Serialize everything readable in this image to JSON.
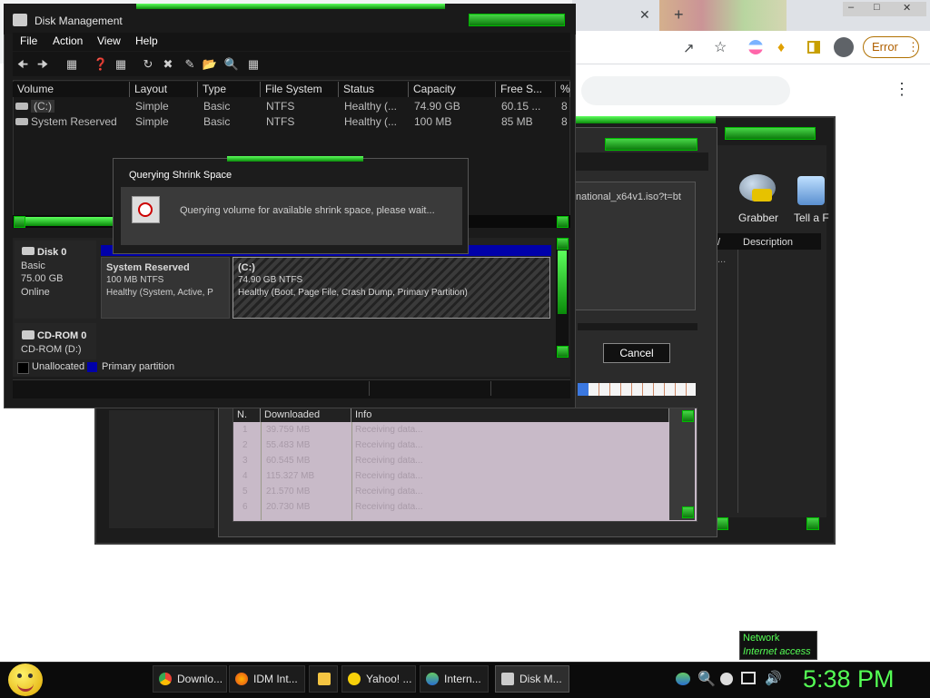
{
  "chrome": {
    "close_tab": "✕",
    "new_tab": "+",
    "error_label": "Error",
    "more": "⋮"
  },
  "idm": {
    "tools": [
      {
        "label": "Grabber"
      },
      {
        "label": "Tell a F"
      }
    ],
    "desc_header": "Description",
    "dl_partial": "national_x64v1.iso?t=bt",
    "cancel_label": "Cancel",
    "table_headers": [
      "N.",
      "Downloaded",
      "Info"
    ],
    "rows": [
      {
        "n": "1",
        "dl": "39.759 MB",
        "info": "Receiving data..."
      },
      {
        "n": "2",
        "dl": "55.483 MB",
        "info": "Receiving data..."
      },
      {
        "n": "3",
        "dl": "60.545 MB",
        "info": "Receiving data..."
      },
      {
        "n": "4",
        "dl": "115.327 MB",
        "info": "Receiving data..."
      },
      {
        "n": "5",
        "dl": "21.570 MB",
        "info": "Receiving data..."
      },
      {
        "n": "6",
        "dl": "20.730 MB",
        "info": "Receiving data..."
      }
    ]
  },
  "disk_mgmt": {
    "title": "Disk Management",
    "menu": [
      "File",
      "Action",
      "View",
      "Help"
    ],
    "columns": [
      "Volume",
      "Layout",
      "Type",
      "File System",
      "Status",
      "Capacity",
      "Free S...",
      "%"
    ],
    "volumes": [
      {
        "volume": "(C:)",
        "layout": "Simple",
        "type": "Basic",
        "fs": "NTFS",
        "status": "Healthy (...",
        "capacity": "74.90 GB",
        "free": "60.15 ...",
        "pct": "8"
      },
      {
        "volume": "System Reserved",
        "layout": "Simple",
        "type": "Basic",
        "fs": "NTFS",
        "status": "Healthy (...",
        "capacity": "100 MB",
        "free": "85 MB",
        "pct": "8"
      }
    ],
    "disk0": {
      "name": "Disk 0",
      "type": "Basic",
      "size": "75.00 GB",
      "state": "Online"
    },
    "sysres": {
      "name": "System Reserved",
      "size": "100 MB NTFS",
      "status": "Healthy (System, Active, P"
    },
    "cpart": {
      "name": "(C:)",
      "size": "74.90 GB NTFS",
      "status": "Healthy (Boot, Page File, Crash Dump, Primary Partition)"
    },
    "cdrom": {
      "name": "CD-ROM 0",
      "drive": "CD-ROM (D:)"
    },
    "legend": [
      "Unallocated",
      "Primary partition"
    ]
  },
  "dialog": {
    "title": "Querying Shrink Space",
    "message": "Querying volume for available shrink space, please wait..."
  },
  "taskbar": {
    "tasks": [
      "Downlo...",
      "IDM Int...",
      "",
      "Yahoo! ...",
      "Intern...",
      "Disk M..."
    ],
    "network_title": "Network",
    "network_sub": "Internet access",
    "clock": "5:38 PM"
  },
  "colors": {
    "accent_green": "#1fd11f",
    "clock_green": "#55ff55",
    "partition_blue": "#0000aa"
  }
}
